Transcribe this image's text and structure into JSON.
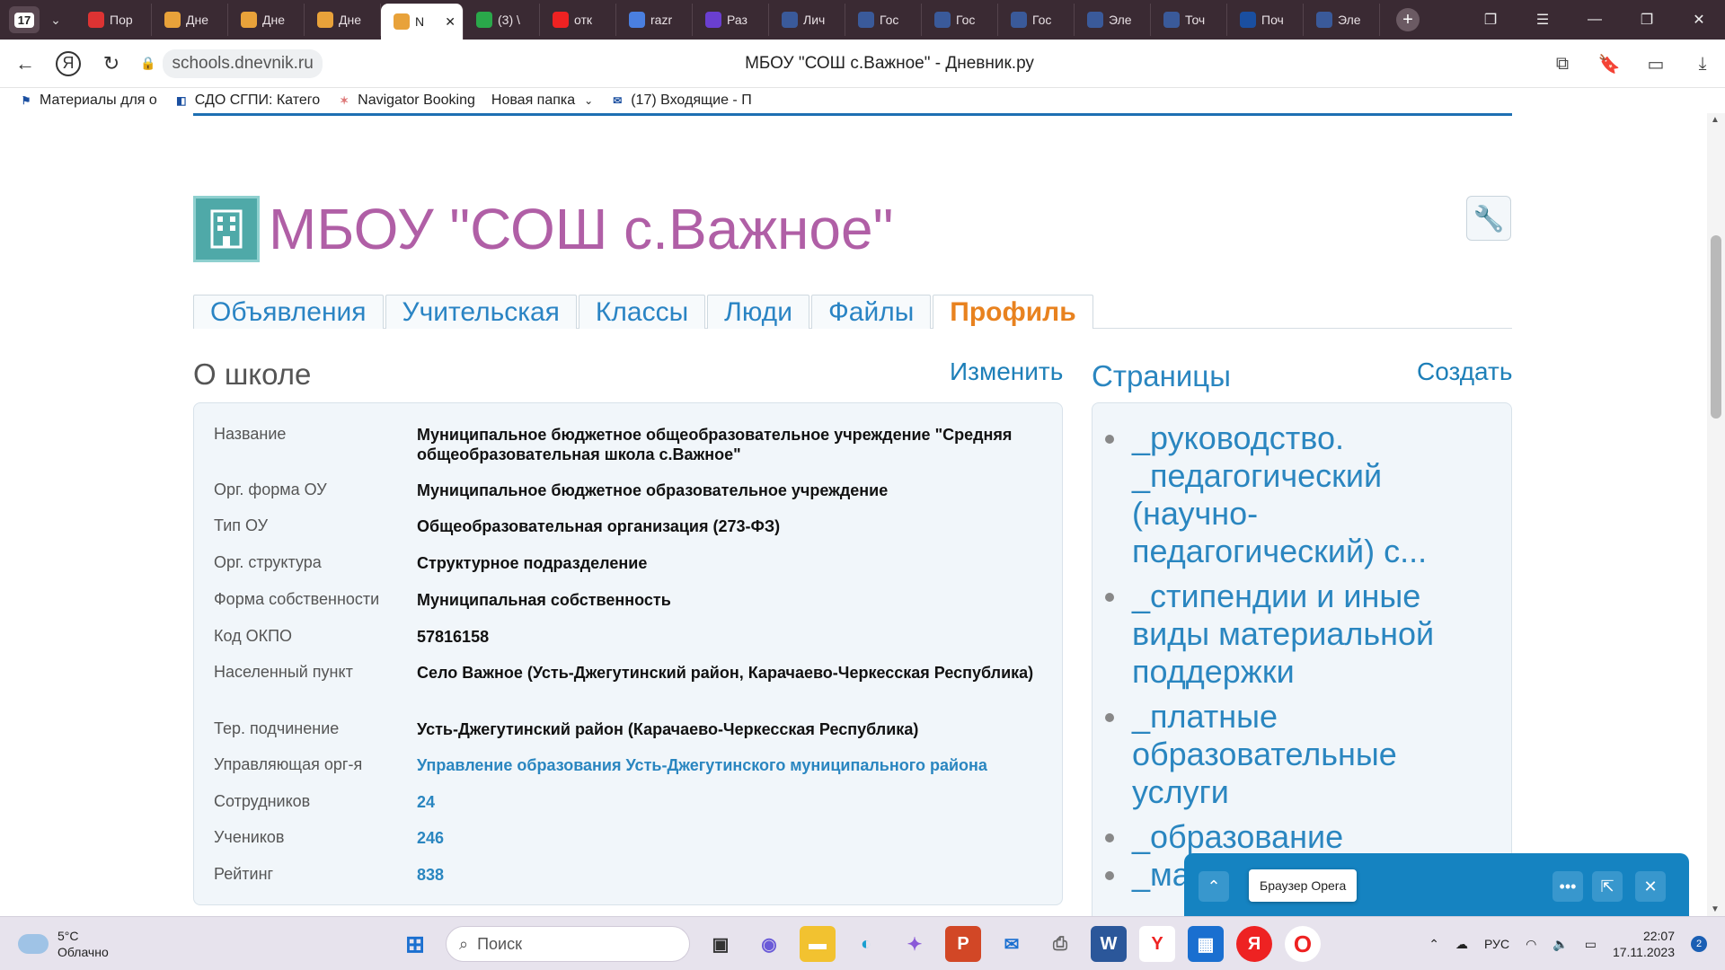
{
  "browser": {
    "tab_count": "17",
    "tabs": [
      {
        "label": "Пор",
        "color": "#d33",
        "icon": "flag-icon"
      },
      {
        "label": "Дне",
        "color": "#e8a23a",
        "icon": "hand-icon"
      },
      {
        "label": "Дне",
        "color": "#e8a23a",
        "icon": "hand-icon"
      },
      {
        "label": "Дне",
        "color": "#e8a23a",
        "icon": "hand-icon"
      },
      {
        "label": "N",
        "color": "#e8a23a",
        "icon": "hand-icon",
        "active": true
      },
      {
        "label": "(3) \\",
        "color": "#2aa84a",
        "icon": "whatsapp-icon"
      },
      {
        "label": "отк",
        "color": "#e22",
        "icon": "yandex-icon"
      },
      {
        "label": "razr",
        "color": "#4a7fe0",
        "icon": "cube-icon"
      },
      {
        "label": "Раз",
        "color": "#6a3fd0",
        "icon": "wave-icon"
      },
      {
        "label": "Лич",
        "color": "#3a5a9a",
        "icon": "emblem-icon"
      },
      {
        "label": "Гос",
        "color": "#3a5a9a",
        "icon": "emblem-icon"
      },
      {
        "label": "Гос",
        "color": "#3a5a9a",
        "icon": "emblem-icon"
      },
      {
        "label": "Гос",
        "color": "#3a5a9a",
        "icon": "emblem-icon"
      },
      {
        "label": "Эле",
        "color": "#3a5a9a",
        "icon": "emblem-icon"
      },
      {
        "label": "Точ",
        "color": "#3a5a9a",
        "icon": "emblem-icon"
      },
      {
        "label": "Поч",
        "color": "#1a4fa0",
        "icon": "mail-icon"
      },
      {
        "label": "Эле",
        "color": "#3a5a9a",
        "icon": "emblem-icon"
      }
    ],
    "url": "schools.dnevnik.ru",
    "page_title": "МБОУ \"СОШ с.Важное\" - Дневник.ру",
    "bookmarks": [
      {
        "label": "Материалы для о"
      },
      {
        "label": "СДО СГПИ: Катего"
      },
      {
        "label": "Navigator Booking"
      },
      {
        "label": "Новая папка"
      },
      {
        "label": "(17) Входящие - П"
      }
    ]
  },
  "school": {
    "name": "МБОУ \"СОШ с.Важное\"",
    "nav_tabs": [
      {
        "label": "Объявления"
      },
      {
        "label": "Учительская"
      },
      {
        "label": "Классы"
      },
      {
        "label": "Люди"
      },
      {
        "label": "Файлы"
      },
      {
        "label": "Профиль",
        "active": true
      }
    ],
    "about_title": "О школе",
    "about_edit": "Изменить",
    "info": [
      {
        "label": "Название",
        "value": "Муниципальное бюджетное общеобразовательное учреждение \"Средняя общеобразовательная школа с.Важное\""
      },
      {
        "label": "Орг. форма ОУ",
        "value": "Муниципальное бюджетное образовательное учреждение"
      },
      {
        "label": "Тип ОУ",
        "value": "Общеобразовательная организация (273-ФЗ)"
      },
      {
        "label": "Орг. структура",
        "value": "Структурное подразделение"
      },
      {
        "label": "Форма собственности",
        "value": "Муниципальная собственность"
      },
      {
        "label": "Код ОКПО",
        "value": "57816158"
      },
      {
        "label": "Населенный пункт",
        "value": "Село Важное (Усть-Джегутинский район, Карачаево-Черкесская Республика)"
      },
      {
        "label": "Тер. подчинение",
        "value": "Усть-Джегутинский район (Карачаево-Черкесская Республика)"
      },
      {
        "label": "Управляющая орг-я",
        "value": "Управление образования Усть-Джегутинского муниципального района",
        "link": true
      },
      {
        "label": "Сотрудников",
        "value": "24",
        "link": true
      },
      {
        "label": "Учеников",
        "value": "246",
        "link": true
      },
      {
        "label": "Рейтинг",
        "value": "838",
        "link": true
      }
    ],
    "pages_title": "Страницы",
    "pages_create": "Создать",
    "pages": [
      "_руководство. _педагогический (научно-педагогический) с...",
      "_стипендии и иные виды материальной поддержки",
      "_платные образовательные услуги",
      "_образование",
      "_ма..."
    ]
  },
  "popup": {
    "tooltip": "Браузер Opera"
  },
  "taskbar": {
    "temperature": "5°C",
    "weather": "Облачно",
    "search_placeholder": "Поиск",
    "language": "РУС",
    "time": "22:07",
    "date": "17.11.2023",
    "notifications": "2"
  }
}
